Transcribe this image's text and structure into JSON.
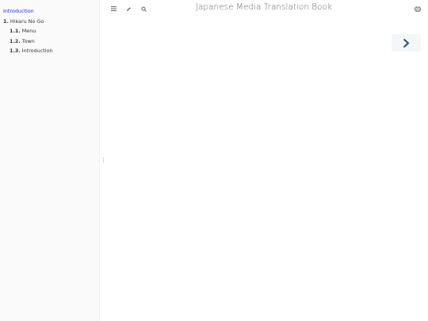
{
  "header": {
    "title": "Japanese Media Translation Book"
  },
  "toolbar": {
    "menu_icon": "hamburger-icon",
    "edit_icon": "pencil-icon",
    "search_icon": "search-icon",
    "print_icon": "printer-icon"
  },
  "sidebar": {
    "items": [
      {
        "number": "",
        "label": "Introduction",
        "active": true
      },
      {
        "number": "1.",
        "label": "Hikaru No Go"
      },
      {
        "number": "1.1.",
        "label": "Menu"
      },
      {
        "number": "1.2.",
        "label": "Town"
      },
      {
        "number": "1.3.",
        "label": "Introduction"
      }
    ]
  },
  "nav": {
    "next_icon": "chevron-right-icon"
  },
  "colors": {
    "accent": "#1f1fff",
    "nav_arrow": "#1d4f8a"
  }
}
